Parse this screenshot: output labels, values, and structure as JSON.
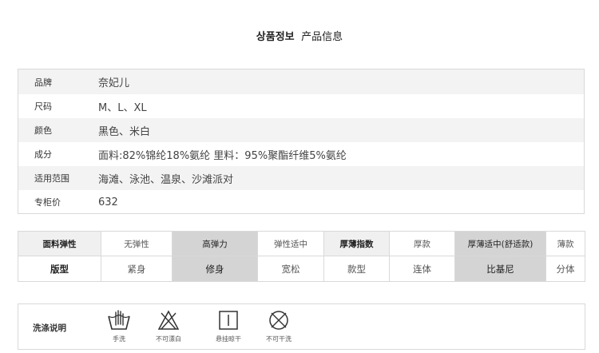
{
  "header": {
    "title_ko": "상품정보",
    "title_cn": "产品信息"
  },
  "info": [
    {
      "key": "品牌",
      "value": "奈妃儿"
    },
    {
      "key": "尺码",
      "value": "M、L、XL"
    },
    {
      "key": "颜色",
      "value": "黑色、米白"
    },
    {
      "key": "成分",
      "value": "面料:82%锦纶18%氨纶 里料：95%聚酯纤维5%氨纶"
    },
    {
      "key": "适用范围",
      "value": "海滩、泳池、温泉、沙滩派对"
    },
    {
      "key": "专柜价",
      "value": "632"
    }
  ],
  "props": {
    "row1": [
      "面料弹性",
      "无弹性",
      "高弹力",
      "弹性适中",
      "厚薄指数",
      "厚款",
      "厚薄适中(舒适款)",
      "薄款"
    ],
    "row2": [
      "版型",
      "紧身",
      "修身",
      "宽松",
      "款型",
      "连体",
      "比基尼",
      "分体"
    ]
  },
  "wash": {
    "label": "洗涤说明",
    "items": [
      {
        "icon": "hand-wash-icon",
        "caption": "手洗"
      },
      {
        "icon": "no-bleach-icon",
        "caption": "不可漂白"
      },
      {
        "icon": "hang-dry-icon",
        "caption": "悬挂晾干"
      },
      {
        "icon": "no-dry-clean-icon",
        "caption": "不可干洗"
      }
    ]
  }
}
